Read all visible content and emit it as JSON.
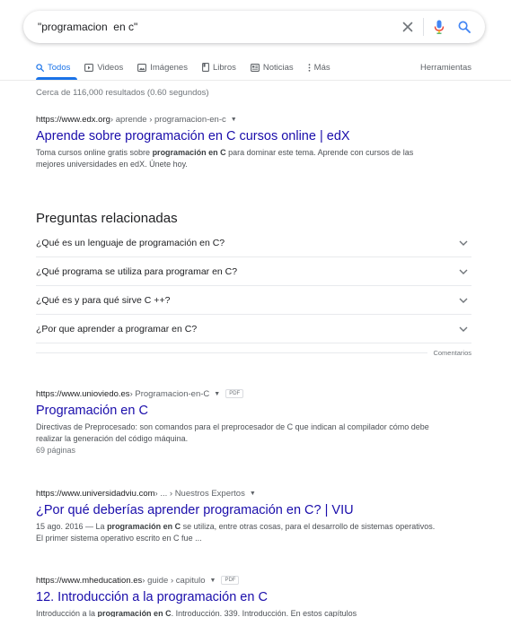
{
  "search": {
    "query": "\"programacion  en c\"",
    "clear_icon": "close-icon",
    "voice_icon": "mic-icon",
    "search_icon": "search-icon"
  },
  "tabs": [
    {
      "label": "Todos",
      "icon": "search-icon",
      "active": true
    },
    {
      "label": "Videos",
      "icon": "play-icon"
    },
    {
      "label": "Imágenes",
      "icon": "image-icon"
    },
    {
      "label": "Libros",
      "icon": "book-icon"
    },
    {
      "label": "Noticias",
      "icon": "news-icon"
    },
    {
      "label": "Más",
      "icon": "more-vertical-icon"
    }
  ],
  "tools_label": "Herramientas",
  "results_count": "Cerca de 116,000 resultados (0.60 segundos)",
  "results": [
    {
      "domain": "https://www.edx.org",
      "path": " › aprende › programacion-en-c",
      "title": "Aprende sobre programación en C cursos online | edX",
      "snippet_before": "Toma cursos online gratis sobre ",
      "snippet_bold": "programación en C",
      "snippet_after": " para dominar este tema. Aprende con cursos de las mejores universidades en edX. Únete hoy."
    },
    {
      "domain": "https://www.unioviedo.es",
      "path": " › Programacion-en-C",
      "badge": "PDF",
      "title": "Programación en C",
      "snippet_before": "Directivas de Preprocesado: son comandos para el preprocesador de C que indican al compilador cómo debe realizar la generación del código máquina.",
      "pages": "69 páginas"
    },
    {
      "domain": "https://www.universidadviu.com",
      "path": " › ... › Nuestros Expertos",
      "title": "¿Por qué deberías aprender programación en C? | VIU",
      "snippet_before": "15 ago. 2016 — La ",
      "snippet_bold": "programación en C",
      "snippet_after": " se utiliza, entre otras cosas, para el desarrollo de sistemas operativos. El primer sistema operativo escrito en C fue ..."
    },
    {
      "domain": "https://www.mheducation.es",
      "path": " › guide › capitulo",
      "badge": "PDF",
      "title": "12. Introducción a la programación en C",
      "snippet_before": "Introducción a la ",
      "snippet_bold": "programación en C",
      "snippet_after": ". Introducción. 339. Introducción. En estos capítulos"
    }
  ],
  "paa": {
    "title": "Preguntas relacionadas",
    "questions": [
      "¿Qué es un lenguaje de programación en C?",
      "¿Qué programa se utiliza para programar en C?",
      "¿Qué es y para qué sirve C ++?",
      "¿Por que aprender a programar en C?"
    ],
    "feedback": "Comentarios"
  },
  "colors": {
    "link": "#1a0dab",
    "accent": "#1a73e8",
    "mic_red": "#ea4335",
    "mic_yellow": "#fbbc05",
    "mic_green": "#34a853"
  }
}
